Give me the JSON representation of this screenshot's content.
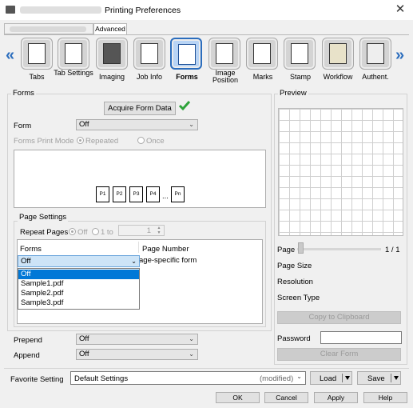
{
  "window": {
    "title": "Printing Preferences",
    "close_glyph": "✕"
  },
  "top_tabs": {
    "advanced": "Advanced"
  },
  "nav": {
    "items": [
      {
        "label": "Tabs",
        "icon": "tabs-icon"
      },
      {
        "label": "Tab Settings",
        "icon": "tab-settings-icon"
      },
      {
        "label": "Imaging",
        "icon": "imaging-icon"
      },
      {
        "label": "Job Info",
        "icon": "job-info-icon"
      },
      {
        "label": "Forms",
        "icon": "forms-icon"
      },
      {
        "label": "Image Position",
        "icon": "image-position-icon"
      },
      {
        "label": "Marks",
        "icon": "marks-icon"
      },
      {
        "label": "Stamp",
        "icon": "stamp-icon"
      },
      {
        "label": "Workflow",
        "icon": "workflow-icon"
      },
      {
        "label": "Authent.",
        "icon": "authentication-icon"
      }
    ],
    "left_arrow": "«",
    "right_arrow": "»"
  },
  "forms": {
    "section_title": "Forms",
    "acquire_button": "Acquire Form Data",
    "acquire_status_icon": "checkmark-icon",
    "form_label": "Form",
    "form_value": "Off",
    "print_mode_label": "Forms Print Mode",
    "mode_repeated": "Repeated",
    "mode_once": "Once",
    "pages": [
      "P1",
      "P2",
      "P3",
      "P4",
      "Pn"
    ],
    "ellipsis": "..."
  },
  "page_settings": {
    "section_title": "Page Settings",
    "repeat_label": "Repeat Pages",
    "off_label": "Off",
    "range_label": "1 to",
    "range_value": "1",
    "col_forms": "Forms",
    "col_page_number": "Page Number",
    "row_value": "Off",
    "row_page_number_text": "age-specific form",
    "dropdown_options": [
      "Off",
      "Sample1.pdf",
      "Sample2.pdf",
      "Sample3.pdf"
    ]
  },
  "prepend": {
    "label": "Prepend",
    "value": "Off"
  },
  "append": {
    "label": "Append",
    "value": "Off"
  },
  "preview": {
    "section_title": "Preview",
    "page_label": "Page",
    "page_count": "1 / 1",
    "page_size_label": "Page Size",
    "resolution_label": "Resolution",
    "screen_type_label": "Screen Type",
    "copy_button": "Copy to Clipboard",
    "password_label": "Password",
    "password_value": "",
    "clear_button": "Clear Form"
  },
  "favorite": {
    "label": "Favorite Setting",
    "value": "Default Settings",
    "modified": "(modified)",
    "load_button": "Load",
    "save_button": "Save"
  },
  "footer": {
    "ok": "OK",
    "cancel": "Cancel",
    "apply": "Apply",
    "help": "Help"
  },
  "colors": {
    "accent": "#2b6dbd",
    "check": "#2ea33a",
    "highlight": "#0078d7"
  }
}
